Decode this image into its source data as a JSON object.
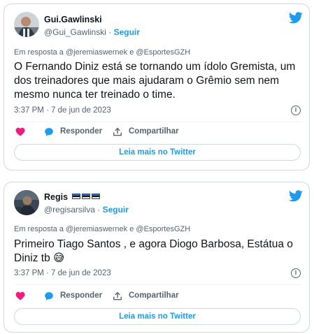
{
  "colors": {
    "accent": "#1d9bf0",
    "like": "#f91880",
    "secondary_text": "#536471",
    "border": "#cfd9de"
  },
  "tweets": [
    {
      "name": "Gui.Gawlinski",
      "handle": "@Gui_Gawlinski",
      "separator": "·",
      "follow": "Seguir",
      "reply_to": "Em resposta a @jeremiaswernek e @EsportesGZH",
      "text": "O Fernando Diniz está se tornando um ídolo Gremista, um dos treinadores que mais ajudaram o Grêmio sem nem mesmo nunca ter treinado o time.",
      "timestamp": "3:37 PM · 7 de jun de 2023",
      "reply_label": "Responder",
      "share_label": "Compartilhar",
      "read_more": "Leia mais no Twitter"
    },
    {
      "name": "Regis",
      "handle": "@regisarsilva",
      "separator": "·",
      "follow": "Seguir",
      "reply_to": "Em resposta a @jeremiaswernek e @EsportesGZH",
      "text": "Primeiro Tiago Santos , e agora Diogo Barbosa, Estátua o Diniz tb",
      "emoji": "😅",
      "timestamp": "3:37 PM · 7 de jun de 2023",
      "reply_label": "Responder",
      "share_label": "Compartilhar",
      "read_more": "Leia mais no Twitter"
    }
  ]
}
